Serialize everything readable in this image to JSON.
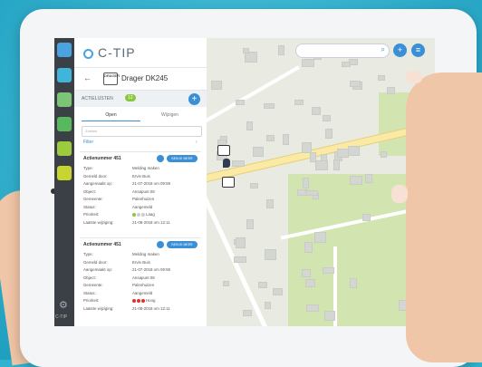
{
  "app": {
    "brand": "C-TIP",
    "rail_footer": "C-TIP"
  },
  "header": {
    "back_icon": "arrow-left-icon",
    "device_badge": "DRAGER",
    "device_title": "Drager DK245"
  },
  "actions_bar": {
    "label": "ACTIELIJSTEN",
    "count": "12"
  },
  "tabs": [
    {
      "label": "Open",
      "active": true
    },
    {
      "label": "Wijzigen",
      "active": false
    }
  ],
  "search": {
    "placeholder": "Zoeken"
  },
  "filter": {
    "label": "Filter",
    "chevron": "›"
  },
  "cards": [
    {
      "id": "Actienummer 451",
      "button": "BEKIJK MEER",
      "rows": [
        {
          "k": "Type:",
          "v": "Melding maken"
        },
        {
          "k": "Gemeld door:",
          "v": "Ervin Buis"
        },
        {
          "k": "Aangemaakt op:",
          "v": "21-07-2018 om 09:59"
        },
        {
          "k": "Object:",
          "v": "Ansapunt 08"
        },
        {
          "k": "Gemeente:",
          "v": "Palenhuizen"
        },
        {
          "k": "Status:",
          "v": "Aangemeld"
        },
        {
          "k": "Prioriteit:",
          "v": "Laag"
        },
        {
          "k": "Laatste wijziging:",
          "v": "21-08-2018 om 12:11"
        }
      ],
      "priority_colors": [
        "#8cc63f",
        "#cccccc",
        "#cccccc"
      ]
    },
    {
      "id": "Actienummer 451",
      "button": "BEKIJK MEER",
      "rows": [
        {
          "k": "Type:",
          "v": "Melding maken"
        },
        {
          "k": "Gemeld door:",
          "v": "Ervin Buis"
        },
        {
          "k": "Aangemaakt op:",
          "v": "21-07-2018 om 09:59"
        },
        {
          "k": "Object:",
          "v": "Ansapunt 08"
        },
        {
          "k": "Gemeente:",
          "v": "Palenhuizen"
        },
        {
          "k": "Status:",
          "v": "Aangemeld"
        },
        {
          "k": "Prioriteit:",
          "v": "Hoog"
        },
        {
          "k": "Laatste wijziging:",
          "v": "21-08-2018 om 12:11"
        }
      ],
      "priority_colors": [
        "#e0312c",
        "#e0312c",
        "#e0312c"
      ]
    }
  ],
  "map": {
    "search_icon": "search-icon",
    "add_icon": "plus-icon",
    "layers_icon": "layers-icon"
  },
  "colors": {
    "accent": "#3a8fd6",
    "rail": "#3b4046",
    "count_badge": "#8cc63f"
  }
}
